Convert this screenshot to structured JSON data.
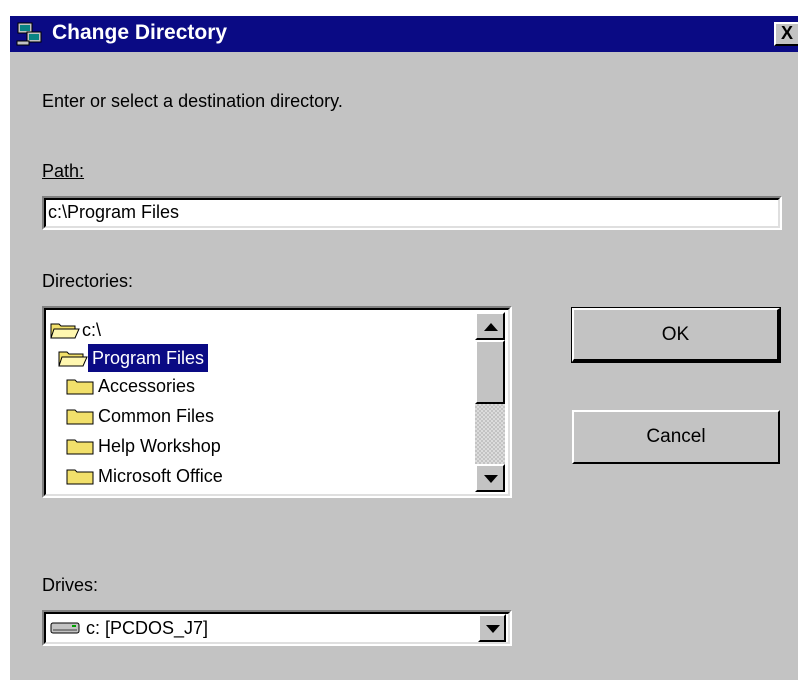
{
  "dialog": {
    "title": "Change Directory",
    "close_label": "X",
    "instruction": "Enter or select a destination directory.",
    "path_label": "Path:",
    "path_value": "c:\\Program Files",
    "directories_label": "Directories:",
    "directories": [
      {
        "label": "c:\\",
        "icon": "open-folder-icon",
        "selected": false
      },
      {
        "label": "Program Files",
        "icon": "open-folder-icon",
        "selected": true
      },
      {
        "label": "Accessories",
        "icon": "folder-icon",
        "selected": false
      },
      {
        "label": "Common Files",
        "icon": "folder-icon",
        "selected": false
      },
      {
        "label": "Help Workshop",
        "icon": "folder-icon",
        "selected": false
      },
      {
        "label": "Microsoft Office",
        "icon": "folder-icon",
        "selected": false
      }
    ],
    "drives_label": "Drives:",
    "drive_value": "c: [PCDOS_J7]",
    "ok_label": "OK",
    "cancel_label": "Cancel"
  },
  "colors": {
    "titlebar": "#0a0a84",
    "face": "#c3c3c3",
    "selection": "#0a0a84",
    "folder": "#f2e06b"
  }
}
